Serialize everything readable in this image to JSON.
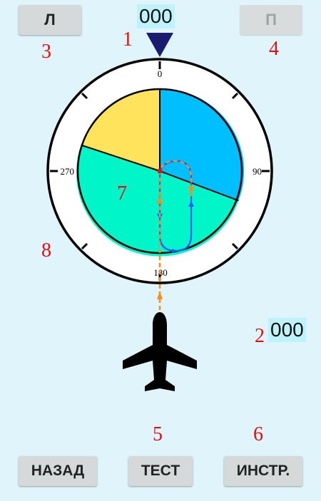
{
  "top": {
    "left_button": "Л",
    "right_button": "П",
    "heading_readout": "000"
  },
  "side": {
    "value_readout": "000"
  },
  "dial": {
    "labels": {
      "n": "0",
      "e": "90",
      "s": "180",
      "w": "270"
    },
    "colors": {
      "yellow_sector": "#ffe35c",
      "blue_sector": "#00bfff",
      "teal_sector": "#00f5c8",
      "pointer": "#1a1a6e",
      "track_blue": "#1e5cff",
      "track_orange": "#ff8c1a"
    }
  },
  "markers": [
    "1",
    "2",
    "3",
    "4",
    "5",
    "6",
    "7",
    "8"
  ],
  "bottom": {
    "back_button": "НАЗАД",
    "test_button": "ТЕСТ",
    "instr_button": "ИНСТР."
  }
}
